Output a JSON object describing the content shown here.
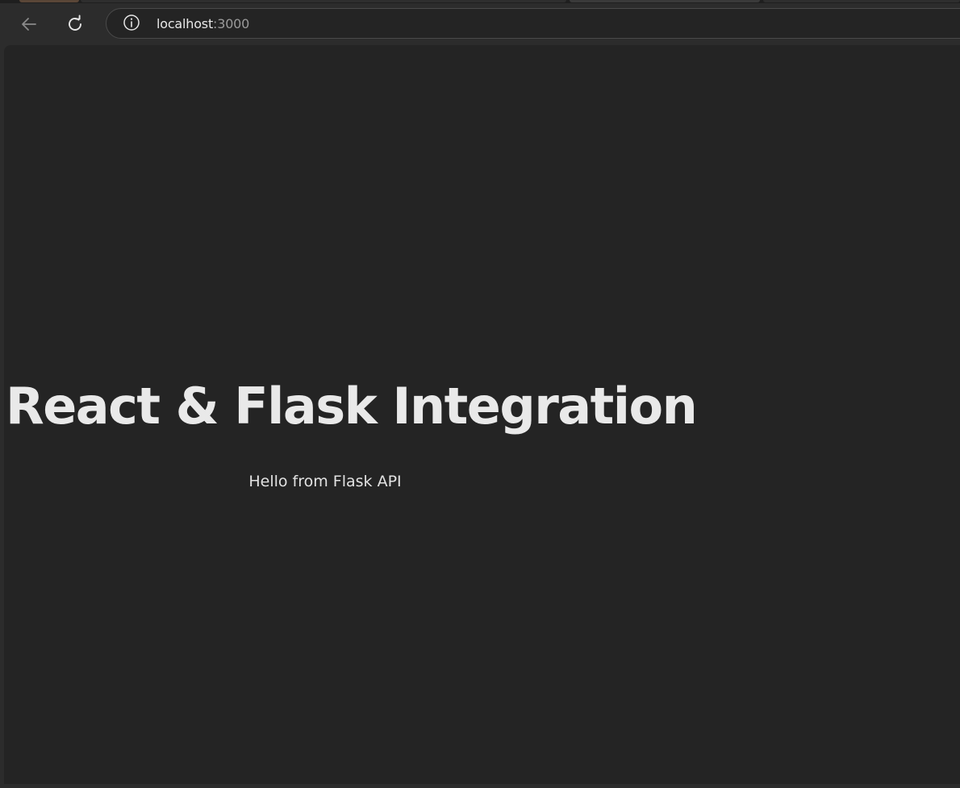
{
  "browser": {
    "address_bar": {
      "host": "localhost",
      "port": ":3000"
    },
    "icons": {
      "back": "back-arrow-icon",
      "reload": "reload-icon",
      "site_info": "info-icon"
    }
  },
  "page": {
    "title": "React & Flask Integration",
    "message": "Hello from Flask API"
  },
  "colors": {
    "page_background": "#242424",
    "text": "#e9e9e9",
    "chrome_background": "#2c2c2c"
  }
}
